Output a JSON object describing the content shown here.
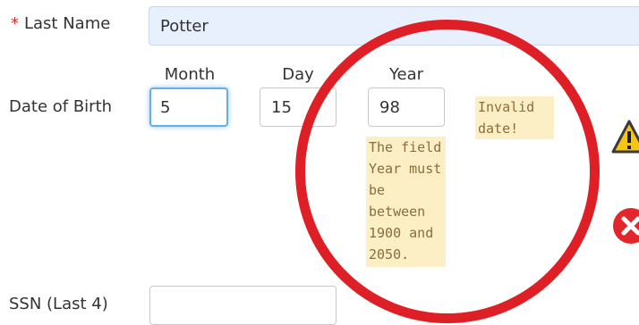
{
  "last_name": {
    "label": "Last Name",
    "required_marker": "*",
    "value": "Potter"
  },
  "dob": {
    "label": "Date of Birth",
    "month": {
      "label": "Month",
      "value": "5"
    },
    "day": {
      "label": "Day",
      "value": "15"
    },
    "year": {
      "label": "Year",
      "value": "98"
    },
    "year_error": "The field\nYear must\nbe\nbetween\n1900 and\n2050.",
    "date_error": "Invalid\ndate!"
  },
  "ssn": {
    "label": "SSN (Last 4)",
    "value": ""
  },
  "icons": {
    "warning": "warning-icon",
    "error": "error-icon"
  },
  "colors": {
    "highlight_circle": "#de1f26",
    "error_bg": "#fcefc6",
    "focus": "#66afe9",
    "autofill": "#e8f0fe"
  }
}
